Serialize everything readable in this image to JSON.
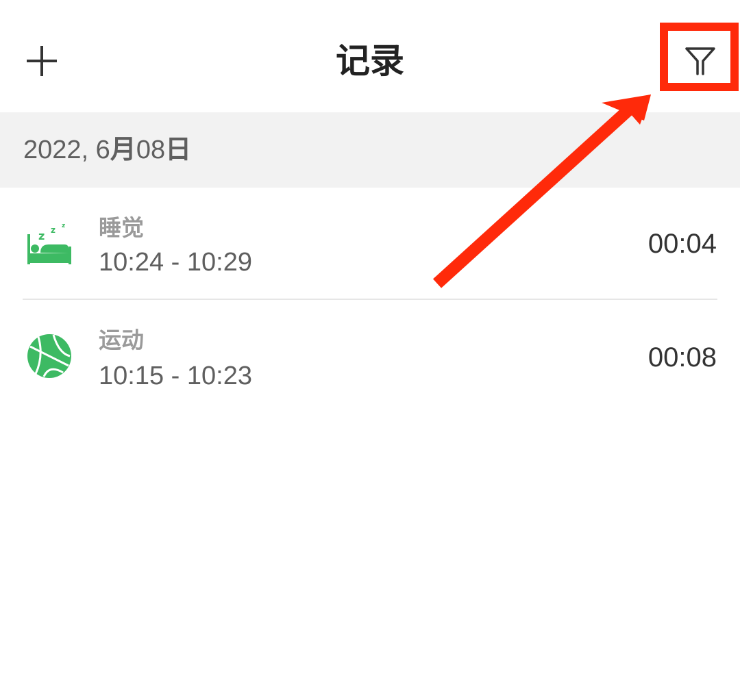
{
  "header": {
    "title": "记录",
    "add_icon": "plus-icon",
    "filter_icon": "filter-icon"
  },
  "date_group": {
    "label_prefix": "2022, 6",
    "label_month": "月",
    "label_day": "08",
    "label_suffix": "日"
  },
  "records": [
    {
      "name": "睡觉",
      "range": "10:24 - 10:29",
      "duration": "00:04",
      "icon": "sleep-icon"
    },
    {
      "name": "运动",
      "range": "10:15 - 10:23",
      "duration": "00:08",
      "icon": "basketball-icon"
    }
  ],
  "colors": {
    "accent_green": "#3dba63",
    "annotation_red": "#ff2a0a",
    "date_header_bg": "#f2f2f2"
  }
}
